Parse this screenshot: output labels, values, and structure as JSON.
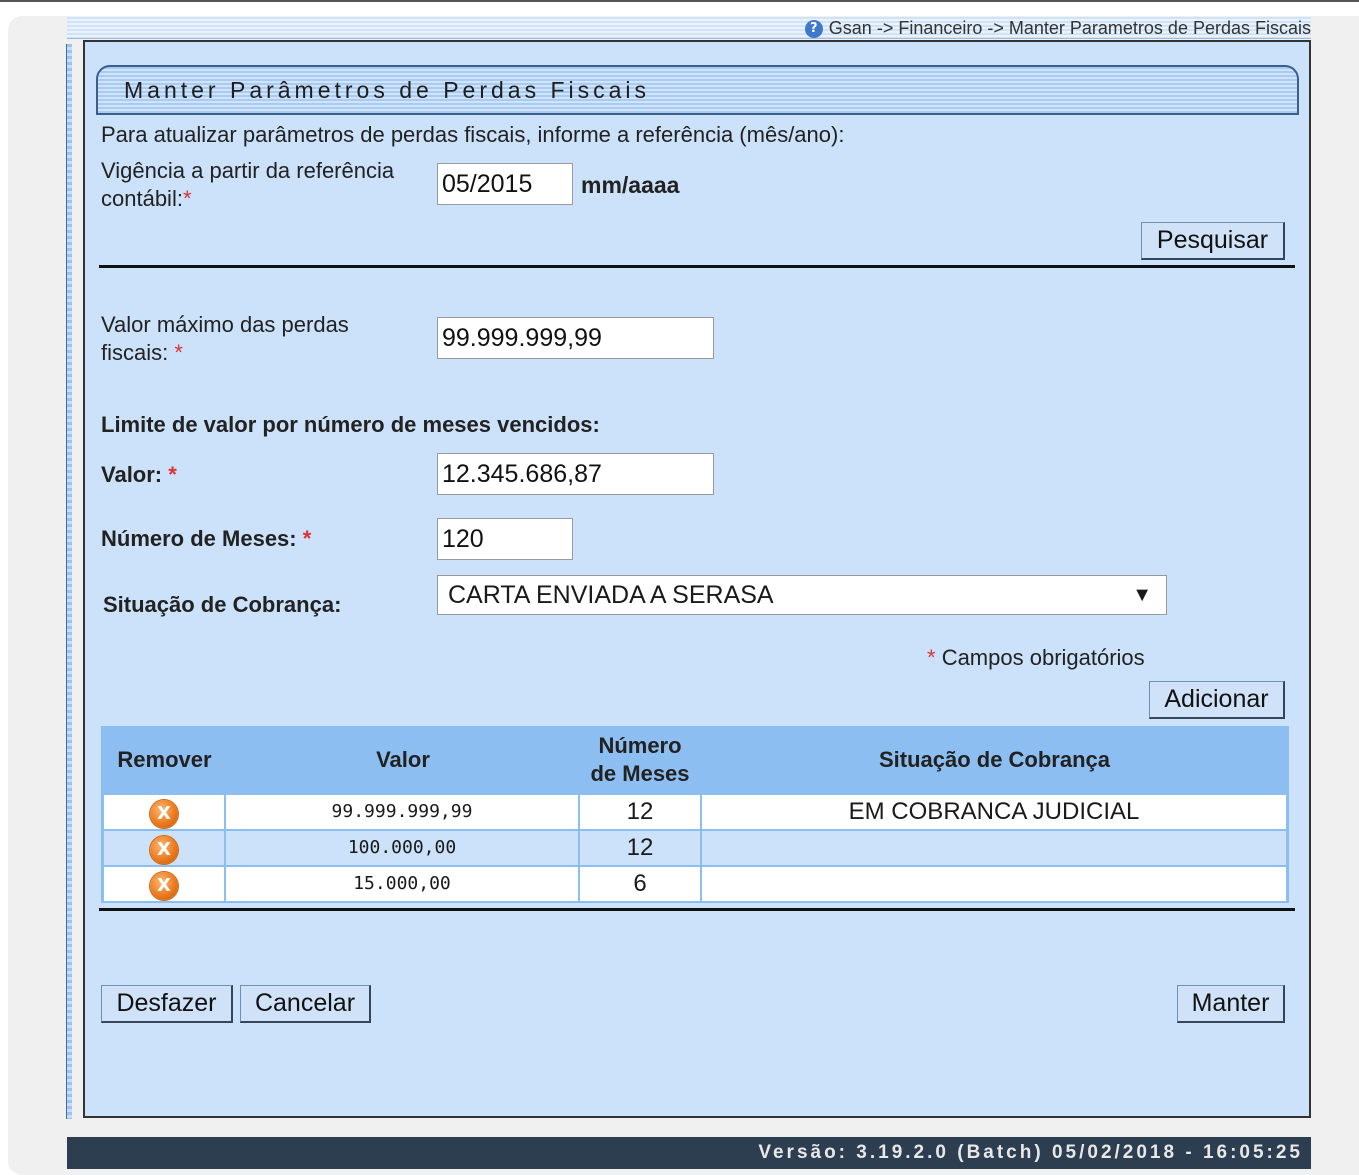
{
  "breadcrumb": "Gsan -> Financeiro -> Manter Parametros de Perdas Fiscais",
  "page_title": "Manter Parâmetros de Perdas Fiscais",
  "instruction": "Para atualizar parâmetros de perdas fiscais, informe a referência (mês/ano):",
  "vigencia": {
    "label_line1": "Vigência a partir da referência",
    "label_line2": "contábil:",
    "required_mark": "*",
    "value": "05/2015",
    "format_hint": "mm/aaaa"
  },
  "search_button": "Pesquisar",
  "valor_maximo": {
    "label_line1": "Valor máximo das perdas",
    "label_line2": "fiscais:",
    "required_mark": "*",
    "value": "99.999.999,99"
  },
  "limite_heading": "Limite de valor por número de meses vencidos:",
  "valor": {
    "label": "Valor:",
    "required_mark": "*",
    "value": "12.345.686,87"
  },
  "numero_meses": {
    "label": "Número de Meses:",
    "required_mark": "*",
    "value": "120"
  },
  "situacao": {
    "label": "Situação de Cobrança:",
    "selected": "CARTA ENVIADA A SERASA"
  },
  "required_note": {
    "mark": "*",
    "text": "Campos obrigatórios"
  },
  "add_button": "Adicionar",
  "table": {
    "headers": {
      "remover": "Remover",
      "valor": "Valor",
      "meses_line1": "Número",
      "meses_line2": "de Meses",
      "situacao": "Situação de Cobrança"
    },
    "rows": [
      {
        "valor": "99.999.999,99",
        "meses": "12",
        "situacao": "EM COBRANCA JUDICIAL"
      },
      {
        "valor": "100.000,00",
        "meses": "12",
        "situacao": ""
      },
      {
        "valor": "15.000,00",
        "meses": "6",
        "situacao": ""
      }
    ],
    "remove_icon": "remove-icon"
  },
  "buttons": {
    "undo": "Desfazer",
    "cancel": "Cancelar",
    "save": "Manter"
  },
  "footer": "Versão: 3.19.2.0 (Batch) 05/02/2018 - 16:05:25",
  "colors": {
    "panel_bg": "#cbe2fa",
    "table_header_bg": "#8dbef1",
    "footer_bg": "#2c3e50",
    "required": "#dd3333",
    "remove_icon": "#e8761a"
  }
}
